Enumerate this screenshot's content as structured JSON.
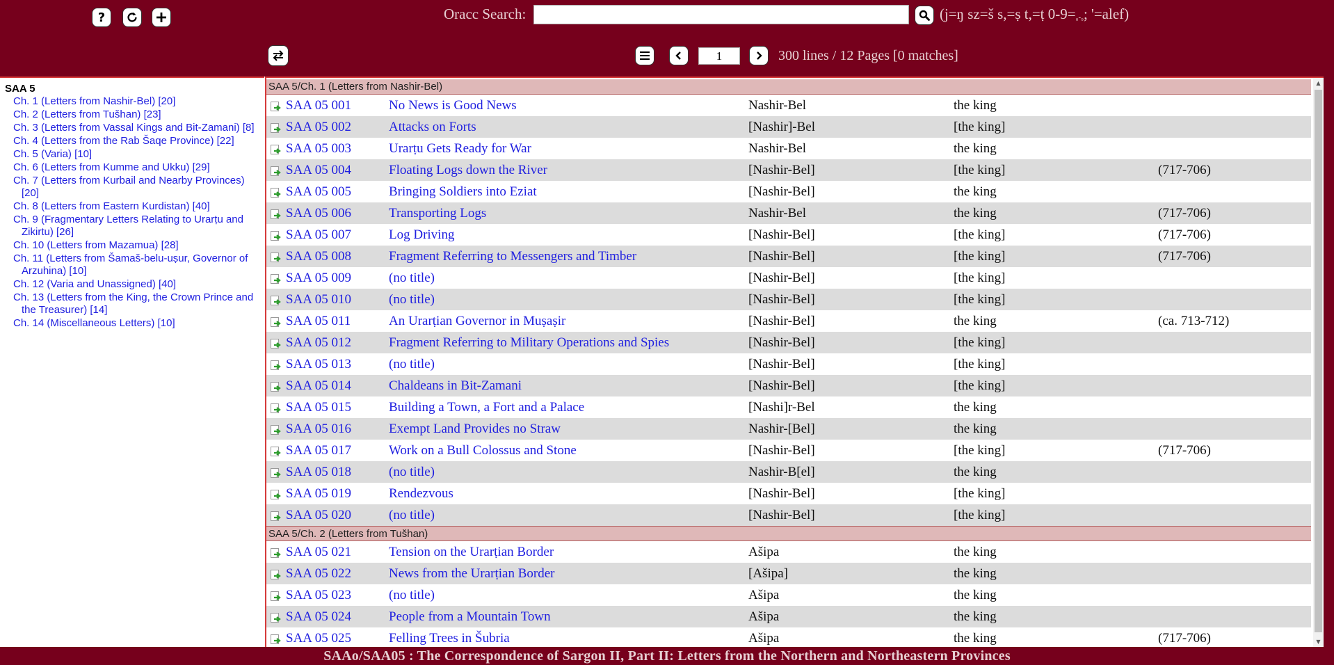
{
  "colors": {
    "brand": "#76001c",
    "link": "#2020e0",
    "group_header_bg": "#dfb8b8",
    "alt_row_bg": "#dcdcdc"
  },
  "header": {
    "search_label": "Oracc Search:",
    "search_value": "",
    "search_hint_pre": "(j=ŋ sz=š s,=ṣ t,=ṭ 0-9=",
    "search_hint_sub": "₀-₉",
    "search_hint_post": "; '=alef)",
    "page_value": "1",
    "pager_status": "300 lines / 12 Pages [0 matches]",
    "icons": {
      "help": "help-icon",
      "reload": "reload-icon",
      "add": "plus-icon",
      "search": "search-icon",
      "swap": "swap-icon",
      "menu": "hamburger-icon",
      "prev": "chevron-left-icon",
      "next": "chevron-right-icon"
    }
  },
  "sidebar": {
    "title": "SAA 5",
    "chapters": [
      "Ch. 1 (Letters from Nashir-Bel) [20]",
      "Ch. 2 (Letters from Tušhan) [23]",
      "Ch. 3 (Letters from Vassal Kings and Bit-Zamani) [8]",
      "Ch. 4 (Letters from the Rab Šaqe Province) [22]",
      "Ch. 5 (Varia) [10]",
      "Ch. 6 (Letters from Kumme and Ukku) [29]",
      "Ch. 7 (Letters from Kurbail and Nearby Provinces) [20]",
      "Ch. 8 (Letters from Eastern Kurdistan) [40]",
      "Ch. 9 (Fragmentary Letters Relating to Urarṭu and Zikirtu) [26]",
      "Ch. 10 (Letters from Mazamua) [28]",
      "Ch. 11 (Letters from Šamaš-belu-uṣur, Governor of Arzuhina) [10]",
      "Ch. 12 (Varia and Unassigned) [40]",
      "Ch. 13 (Letters from the King, the Crown Prince and the Treasurer) [14]",
      "Ch. 14 (Miscellaneous Letters) [10]"
    ]
  },
  "groups": [
    {
      "header": "SAA 5/Ch. 1 (Letters from Nashir-Bel)",
      "rows": [
        {
          "id": "SAA 05 001",
          "title": "No News is Good News",
          "author": "Nashir-Bel",
          "recipient": "the king",
          "date": ""
        },
        {
          "id": "SAA 05 002",
          "title": "Attacks on Forts",
          "author": "[Nashir]-Bel",
          "recipient": "[the king]",
          "date": ""
        },
        {
          "id": "SAA 05 003",
          "title": "Urarṭu Gets Ready for War",
          "author": "Nashir-Bel",
          "recipient": "the king",
          "date": ""
        },
        {
          "id": "SAA 05 004",
          "title": "Floating Logs down the River",
          "author": "[Nashir-Bel]",
          "recipient": "[the king]",
          "date": "(717-706)"
        },
        {
          "id": "SAA 05 005",
          "title": "Bringing Soldiers into Eziat",
          "author": "[Nashir-Bel]",
          "recipient": "the king",
          "date": ""
        },
        {
          "id": "SAA 05 006",
          "title": "Transporting Logs",
          "author": "Nashir-Bel",
          "recipient": "the king",
          "date": "(717-706)"
        },
        {
          "id": "SAA 05 007",
          "title": "Log Driving",
          "author": "[Nashir-Bel]",
          "recipient": "[the king]",
          "date": "(717-706)"
        },
        {
          "id": "SAA 05 008",
          "title": "Fragment Referring to Messengers and Timber",
          "author": "[Nashir-Bel]",
          "recipient": "[the king]",
          "date": "(717-706)"
        },
        {
          "id": "SAA 05 009",
          "title": "(no title)",
          "author": "[Nashir-Bel]",
          "recipient": "[the king]",
          "date": ""
        },
        {
          "id": "SAA 05 010",
          "title": "(no title)",
          "author": "[Nashir-Bel]",
          "recipient": "[the king]",
          "date": ""
        },
        {
          "id": "SAA 05 011",
          "title": "An Urarṭian Governor in Muṣaṣir",
          "author": "[Nashir-Bel]",
          "recipient": "the king",
          "date": "(ca. 713-712)"
        },
        {
          "id": "SAA 05 012",
          "title": "Fragment Referring to Military Operations and Spies",
          "author": "[Nashir-Bel]",
          "recipient": "[the king]",
          "date": ""
        },
        {
          "id": "SAA 05 013",
          "title": "(no title)",
          "author": "[Nashir-Bel]",
          "recipient": "[the king]",
          "date": ""
        },
        {
          "id": "SAA 05 014",
          "title": "Chaldeans in Bit-Zamani",
          "author": "[Nashir-Bel]",
          "recipient": "[the king]",
          "date": ""
        },
        {
          "id": "SAA 05 015",
          "title": "Building a Town, a Fort and a Palace",
          "author": "[Nashi]r-Bel",
          "recipient": "the king",
          "date": ""
        },
        {
          "id": "SAA 05 016",
          "title": "Exempt Land Provides no Straw",
          "author": "Nashir-[Bel]",
          "recipient": "the king",
          "date": ""
        },
        {
          "id": "SAA 05 017",
          "title": "Work on a Bull Colossus and Stone",
          "author": "[Nashir-Bel]",
          "recipient": "[the king]",
          "date": "(717-706)"
        },
        {
          "id": "SAA 05 018",
          "title": "(no title)",
          "author": "Nashir-B[el]",
          "recipient": "the king",
          "date": ""
        },
        {
          "id": "SAA 05 019",
          "title": "Rendezvous",
          "author": "[Nashir-Bel]",
          "recipient": "[the king]",
          "date": ""
        },
        {
          "id": "SAA 05 020",
          "title": "(no title)",
          "author": "[Nashir-Bel]",
          "recipient": "[the king]",
          "date": ""
        }
      ]
    },
    {
      "header": "SAA 5/Ch. 2 (Letters from Tušhan)",
      "rows": [
        {
          "id": "SAA 05 021",
          "title": "Tension on the Urarṭian Border",
          "author": "Ašipa",
          "recipient": "the king",
          "date": ""
        },
        {
          "id": "SAA 05 022",
          "title": "News from the Urarṭian Border",
          "author": "[Ašipa]",
          "recipient": "the king",
          "date": ""
        },
        {
          "id": "SAA 05 023",
          "title": "(no title)",
          "author": "Ašipa",
          "recipient": "the king",
          "date": ""
        },
        {
          "id": "SAA 05 024",
          "title": "People from a Mountain Town",
          "author": "Ašipa",
          "recipient": "the king",
          "date": ""
        },
        {
          "id": "SAA 05 025",
          "title": "Felling Trees in Šubria",
          "author": "Ašipa",
          "recipient": "the king",
          "date": "(717-706)"
        }
      ]
    }
  ],
  "footer": {
    "text": "SAAo/SAA05 : The Correspondence of Sargon II, Part II: Letters from the Northern and Northeastern Provinces"
  }
}
